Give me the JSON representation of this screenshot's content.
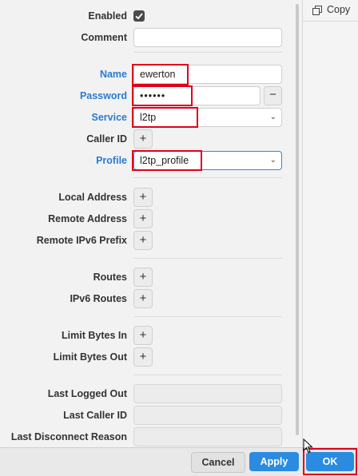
{
  "form": {
    "enabled": {
      "label": "Enabled",
      "checked": true,
      "icon": "checkmark-icon"
    },
    "comment": {
      "label": "Comment",
      "value": ""
    },
    "name": {
      "label": "Name",
      "value": "ewerton"
    },
    "password": {
      "label": "Password",
      "value": "••••••",
      "remove_label": "−"
    },
    "service": {
      "label": "Service",
      "value": "l2tp"
    },
    "caller_id": {
      "label": "Caller ID",
      "add_label": "+"
    },
    "profile": {
      "label": "Profile",
      "value": "l2tp_profile"
    },
    "local_address": {
      "label": "Local Address",
      "add_label": "+"
    },
    "remote_address": {
      "label": "Remote Address",
      "add_label": "+"
    },
    "remote_ipv6_prefix": {
      "label": "Remote IPv6 Prefix",
      "add_label": "+"
    },
    "routes": {
      "label": "Routes",
      "add_label": "+"
    },
    "ipv6_routes": {
      "label": "IPv6 Routes",
      "add_label": "+"
    },
    "limit_bytes_in": {
      "label": "Limit Bytes In",
      "add_label": "+"
    },
    "limit_bytes_out": {
      "label": "Limit Bytes Out",
      "add_label": "+"
    },
    "last_logged_out": {
      "label": "Last Logged Out",
      "value": ""
    },
    "last_caller_id": {
      "label": "Last Caller ID",
      "value": ""
    },
    "last_disconnect_reason": {
      "label": "Last Disconnect Reason",
      "value": ""
    }
  },
  "side_panel": {
    "copy_label": "Copy",
    "copy_icon": "copy-icon"
  },
  "footer": {
    "cancel_label": "Cancel",
    "apply_label": "Apply",
    "ok_label": "OK"
  },
  "colors": {
    "required_label": "#2a7bd4",
    "primary_button": "#2b8be0",
    "highlight_box": "#e0001a"
  },
  "icons": {
    "dropdown": "chevron-down-icon",
    "cursor": "mouse-pointer-icon"
  }
}
